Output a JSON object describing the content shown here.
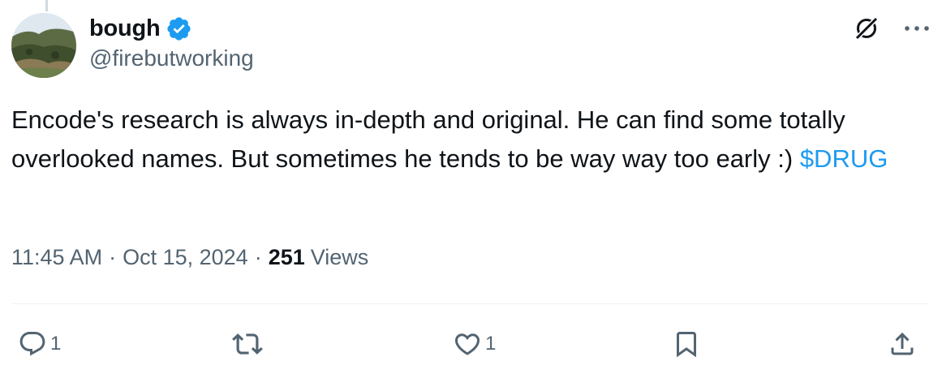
{
  "author": {
    "display_name": "bough",
    "handle": "@firebutworking",
    "verified": true
  },
  "tweet": {
    "text": "Encode's research is always in-depth and original. He can find some totally overlooked names. But sometimes he tends to be way way too early :) ",
    "cashtag": "$DRUG",
    "time": "11:45 AM",
    "separator": "·",
    "date": "Oct 15, 2024",
    "views_count": "251",
    "views_label": "Views"
  },
  "actions": {
    "reply_count": "1",
    "repost_count": "",
    "like_count": "1"
  },
  "icons": {
    "verified": "verified-badge-icon",
    "grok": "grok-icon",
    "more": "more-icon",
    "reply": "reply-icon",
    "repost": "repost-icon",
    "like": "heart-icon",
    "bookmark": "bookmark-icon",
    "share": "share-icon"
  },
  "colors": {
    "accent": "#1d9bf0",
    "text": "#0f1419",
    "secondary": "#536471",
    "divider": "#eff3f4"
  }
}
